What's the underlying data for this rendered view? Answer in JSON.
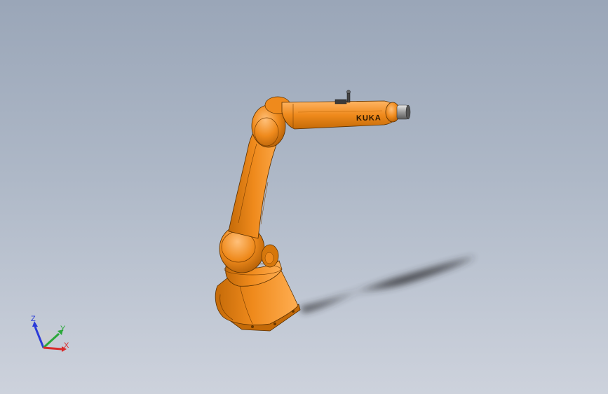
{
  "model": {
    "name": "robot-arm",
    "brand_label": "KUKA"
  },
  "triad": {
    "z_label": "Z",
    "y_label": "Y",
    "x_label": "X"
  },
  "colors": {
    "background_top": "#9aa6b8",
    "background_bottom": "#cdd2dc",
    "robot_orange": "#ef8a1c",
    "robot_shade": "#c46a08",
    "robot_highlight": "#ffae52",
    "shadow": "#2e2e30",
    "axis_x": "#d92a2a",
    "axis_y": "#2aa83a",
    "axis_z": "#2a3ad9"
  }
}
